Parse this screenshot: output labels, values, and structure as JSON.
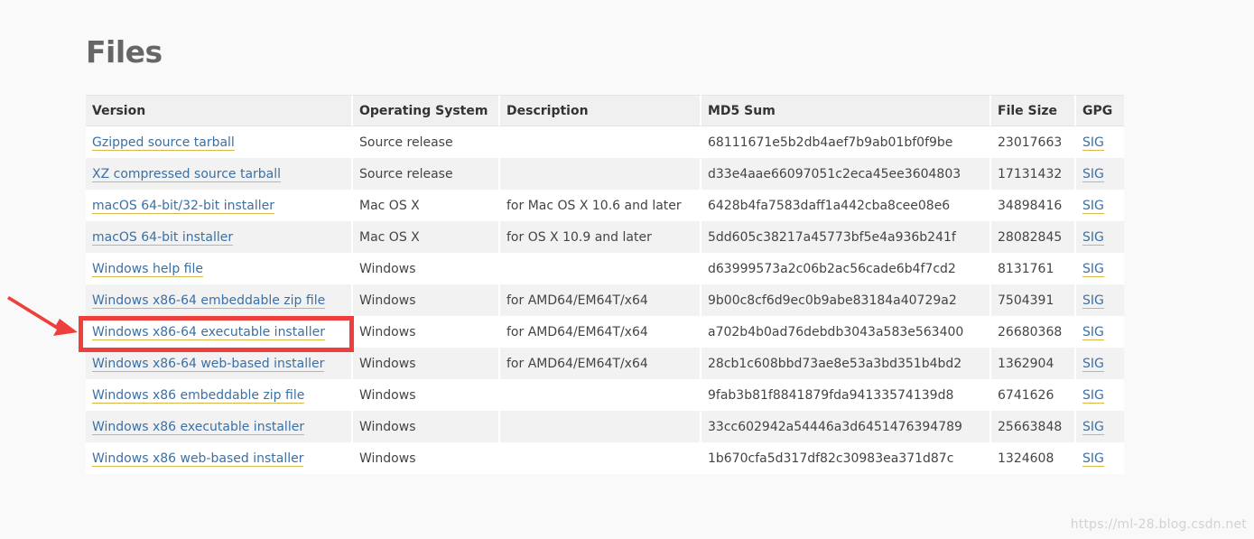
{
  "page": {
    "title": "Files",
    "watermark": "https://ml-28.blog.csdn.net"
  },
  "table": {
    "headers": {
      "version": "Version",
      "os": "Operating System",
      "description": "Description",
      "md5": "MD5 Sum",
      "size": "File Size",
      "gpg": "GPG"
    },
    "rows": [
      {
        "version": "Gzipped source tarball",
        "os": "Source release",
        "description": "",
        "md5": "68111671e5b2db4aef7b9ab01bf0f9be",
        "size": "23017663",
        "gpg": "SIG"
      },
      {
        "version": "XZ compressed source tarball",
        "os": "Source release",
        "description": "",
        "md5": "d33e4aae66097051c2eca45ee3604803",
        "size": "17131432",
        "gpg": "SIG"
      },
      {
        "version": "macOS 64-bit/32-bit installer",
        "os": "Mac OS X",
        "description": "for Mac OS X 10.6 and later",
        "md5": "6428b4fa7583daff1a442cba8cee08e6",
        "size": "34898416",
        "gpg": "SIG"
      },
      {
        "version": "macOS 64-bit installer",
        "os": "Mac OS X",
        "description": "for OS X 10.9 and later",
        "md5": "5dd605c38217a45773bf5e4a936b241f",
        "size": "28082845",
        "gpg": "SIG"
      },
      {
        "version": "Windows help file",
        "os": "Windows",
        "description": "",
        "md5": "d63999573a2c06b2ac56cade6b4f7cd2",
        "size": "8131761",
        "gpg": "SIG"
      },
      {
        "version": "Windows x86-64 embeddable zip file",
        "os": "Windows",
        "description": "for AMD64/EM64T/x64",
        "md5": "9b00c8cf6d9ec0b9abe83184a40729a2",
        "size": "7504391",
        "gpg": "SIG"
      },
      {
        "version": "Windows x86-64 executable installer",
        "os": "Windows",
        "description": "for AMD64/EM64T/x64",
        "md5": "a702b4b0ad76debdb3043a583e563400",
        "size": "26680368",
        "gpg": "SIG"
      },
      {
        "version": "Windows x86-64 web-based installer",
        "os": "Windows",
        "description": "for AMD64/EM64T/x64",
        "md5": "28cb1c608bbd73ae8e53a3bd351b4bd2",
        "size": "1362904",
        "gpg": "SIG"
      },
      {
        "version": "Windows x86 embeddable zip file",
        "os": "Windows",
        "description": "",
        "md5": "9fab3b81f8841879fda94133574139d8",
        "size": "6741626",
        "gpg": "SIG"
      },
      {
        "version": "Windows x86 executable installer",
        "os": "Windows",
        "description": "",
        "md5": "33cc602942a54446a3d6451476394789",
        "size": "25663848",
        "gpg": "SIG"
      },
      {
        "version": "Windows x86 web-based installer",
        "os": "Windows",
        "description": "",
        "md5": "1b670cfa5d317df82c30983ea371d87c",
        "size": "1324608",
        "gpg": "SIG"
      }
    ]
  },
  "annotation": {
    "color": "#ef3f3d",
    "icon": "arrow-right-icon"
  },
  "colors": {
    "link": "#3b70a5",
    "link_underline": "#d6b74a",
    "header_bg": "#f0f0f0",
    "row_alt_bg": "#f2f2f2"
  }
}
